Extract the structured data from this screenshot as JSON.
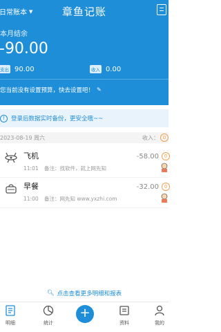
{
  "header": {
    "book_name": "日常账本",
    "app_title": "章鱼记账",
    "balance_label": "本月结余",
    "balance": "-90.00",
    "expense_label": "支出",
    "expense_value": "90.00",
    "income_label": "收入",
    "income_value": "0.00",
    "budget_notice": "您当前没有设置预算，快去设置吧！"
  },
  "notice": {
    "text": "登录后数据实时备份，更安全哦~~"
  },
  "day": {
    "date": "2023-08-19 周六",
    "summary": "收入：",
    "badge": "0"
  },
  "records": [
    {
      "title": "飞机",
      "time": "11:01",
      "note": "备注：找软件，就上网先知",
      "amount": "-58.00",
      "icon": "plane-icon",
      "badge": "0"
    },
    {
      "title": "早餐",
      "time": "11:00",
      "note": "备注：网先知 www.yxzhi.com",
      "amount": "-32.00",
      "icon": "breakfast-icon",
      "badge": "0"
    }
  ],
  "more_link": "点击查看更多明细和报表",
  "tabs": [
    {
      "label": "明细",
      "icon": "list-icon"
    },
    {
      "label": "统计",
      "icon": "pie-chart-icon"
    },
    {
      "label": "+",
      "icon": "add-icon"
    },
    {
      "label": "资料",
      "icon": "document-icon"
    },
    {
      "label": "我的",
      "icon": "user-icon"
    }
  ],
  "colors": {
    "primary": "#1e8ed9",
    "badge": "#f0a050"
  }
}
